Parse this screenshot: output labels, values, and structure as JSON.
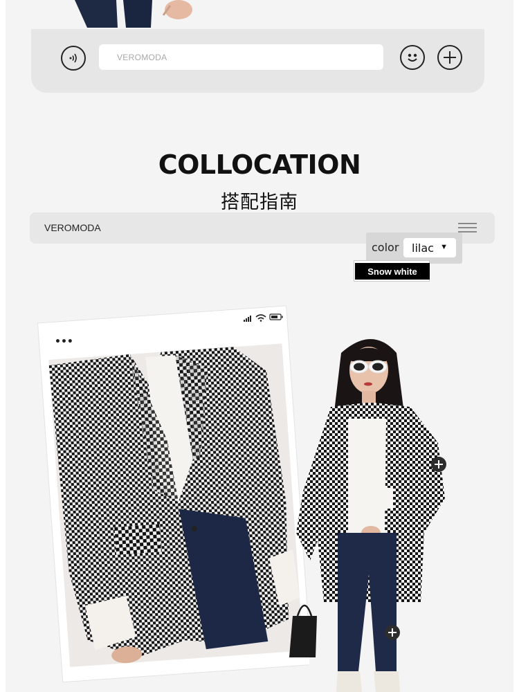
{
  "chat_bar": {
    "input_placeholder": "VEROMODA",
    "voice_icon": "voice-icon",
    "emoji_icon": "emoji-icon",
    "plus_icon": "plus-circle-icon"
  },
  "section": {
    "title": "COLLOCATION",
    "subtitle": "搭配指南"
  },
  "brand_bar": {
    "brand": "VEROMODA",
    "menu_icon": "hamburger-menu-icon"
  },
  "color_selector": {
    "label": "color",
    "selected": "lilac",
    "option": "Snow white"
  },
  "phone": {
    "dots": "•••",
    "status_icons": [
      "signal-icon",
      "wifi-icon",
      "battery-icon"
    ]
  },
  "colors": {
    "page_bg": "#f4f4f4",
    "bar_bg": "#e6e6e6",
    "text": "#111111",
    "option_bg": "#000000"
  }
}
